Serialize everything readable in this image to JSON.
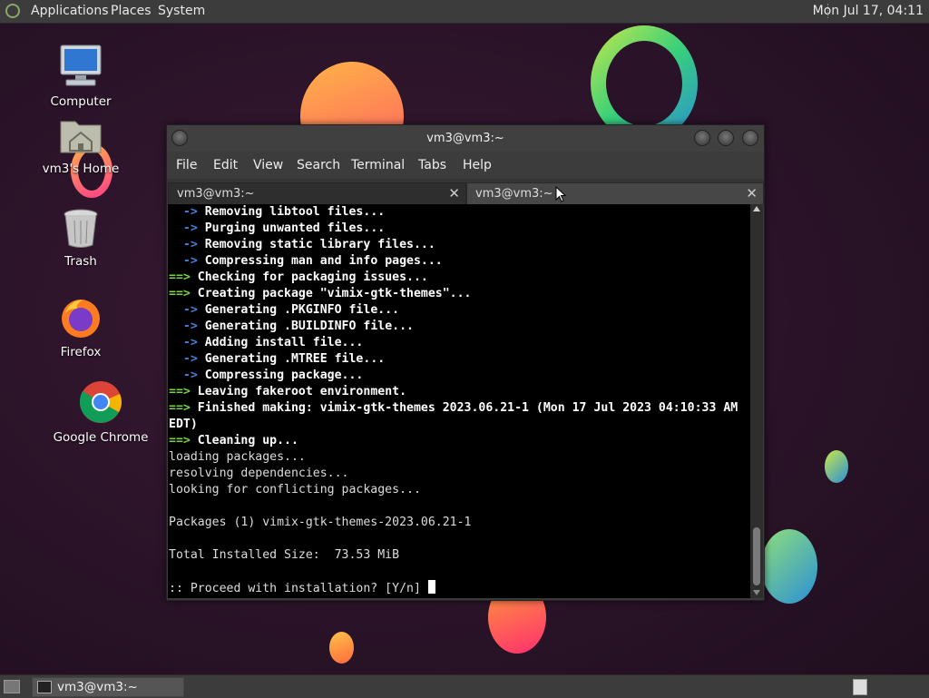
{
  "top_panel": {
    "menus": [
      "Applications",
      "Places",
      "System"
    ],
    "clock": "Mon Jul 17, 04:11"
  },
  "desktop_icons": [
    {
      "label": "Computer",
      "icon": "computer-icon"
    },
    {
      "label": "vm3's Home",
      "icon": "home-folder-icon"
    },
    {
      "label": "Trash",
      "icon": "trash-icon"
    },
    {
      "label": "Firefox",
      "icon": "firefox-icon"
    },
    {
      "label": "Google Chrome",
      "icon": "chrome-icon"
    }
  ],
  "terminal": {
    "title": "vm3@vm3:~",
    "menu": [
      "File",
      "Edit",
      "View",
      "Search",
      "Terminal",
      "Tabs",
      "Help"
    ],
    "tabs": [
      {
        "label": "vm3@vm3:~",
        "active": false
      },
      {
        "label": "vm3@vm3:~",
        "active": true
      }
    ],
    "lines": [
      {
        "prefix": "  -> ",
        "kind": "sub",
        "text": "Removing libtool files..."
      },
      {
        "prefix": "  -> ",
        "kind": "sub",
        "text": "Purging unwanted files..."
      },
      {
        "prefix": "  -> ",
        "kind": "sub",
        "text": "Removing static library files..."
      },
      {
        "prefix": "  -> ",
        "kind": "sub",
        "text": "Compressing man and info pages..."
      },
      {
        "prefix": "==> ",
        "kind": "main",
        "text": "Checking for packaging issues..."
      },
      {
        "prefix": "==> ",
        "kind": "main",
        "text": "Creating package \"vimix-gtk-themes\"..."
      },
      {
        "prefix": "  -> ",
        "kind": "sub",
        "text": "Generating .PKGINFO file..."
      },
      {
        "prefix": "  -> ",
        "kind": "sub",
        "text": "Generating .BUILDINFO file..."
      },
      {
        "prefix": "  -> ",
        "kind": "sub",
        "text": "Adding install file..."
      },
      {
        "prefix": "  -> ",
        "kind": "sub",
        "text": "Generating .MTREE file..."
      },
      {
        "prefix": "  -> ",
        "kind": "sub",
        "text": "Compressing package..."
      },
      {
        "prefix": "==> ",
        "kind": "main",
        "text": "Leaving fakeroot environment."
      },
      {
        "prefix": "==> ",
        "kind": "main",
        "text": "Finished making: vimix-gtk-themes 2023.06.21-1 (Mon 17 Jul 2023 04:10:33 AM"
      },
      {
        "prefix": "",
        "kind": "boldplain",
        "text": "EDT)"
      },
      {
        "prefix": "==> ",
        "kind": "main",
        "text": "Cleaning up..."
      },
      {
        "prefix": "",
        "kind": "plain",
        "text": "loading packages..."
      },
      {
        "prefix": "",
        "kind": "plain",
        "text": "resolving dependencies..."
      },
      {
        "prefix": "",
        "kind": "plain",
        "text": "looking for conflicting packages..."
      },
      {
        "prefix": "",
        "kind": "plain",
        "text": ""
      },
      {
        "prefix": "",
        "kind": "plain",
        "text": "Packages (1) vimix-gtk-themes-2023.06.21-1"
      },
      {
        "prefix": "",
        "kind": "plain",
        "text": ""
      },
      {
        "prefix": "",
        "kind": "plain",
        "text": "Total Installed Size:  73.53 MiB"
      },
      {
        "prefix": "",
        "kind": "plain",
        "text": ""
      },
      {
        "prefix": "",
        "kind": "prompt",
        "text": ":: Proceed with installation? [Y/n] "
      }
    ]
  },
  "taskbar": {
    "window_label": "vm3@vm3:~"
  },
  "colors": {
    "arrow_sub": "#4a7fd6",
    "arrow_main": "#7bd33b",
    "panel": "#3c3c3c",
    "terminal_bg": "#000000"
  }
}
